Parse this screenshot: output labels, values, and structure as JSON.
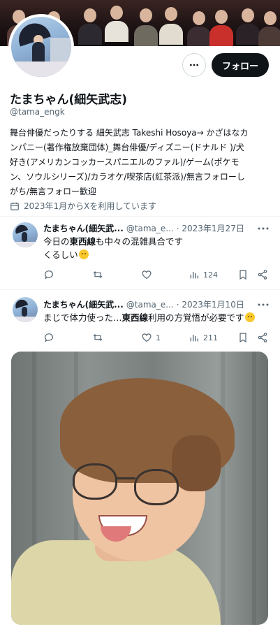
{
  "profile": {
    "display_name": "たまちゃん(細矢武志)",
    "handle": "@tama_engk",
    "bio": "舞台俳優だったりする 細矢武志 Takeshi Hosoya→ かざはなカ\nンパニー(著作権放棄団体)_舞台俳優/ディズニー(ドナルド )/犬\n好き(アメリカンコッカースパニエルのファル)/ゲーム(ポケモ\nン、ソウルシリーズ)/カラオケ/喫茶店(紅茶派)/無言フォローし\nがち/無言フォロー歓迎",
    "joined": "2023年1月からXを利用しています",
    "follow_label": "フォロー"
  },
  "tweets": [
    {
      "name": "たまちゃん(細矢武...",
      "handle": "@tama_e...",
      "date": "· 2023年1月27日",
      "line1_pre": "今日の",
      "line1_bold": "東西線",
      "line1_post": "も中々の混雑具合です",
      "line2": "くるしい",
      "reply": "",
      "retweet": "",
      "like": "",
      "views": "124"
    },
    {
      "name": "たまちゃん(細矢武...",
      "handle": "@tama_e...",
      "date": "· 2023年1月10日",
      "line1_pre": "まじで体力使った…",
      "line1_bold": "東西線",
      "line1_post": "利用の方覚悟が必要です",
      "reply": "",
      "retweet": "",
      "like": "1",
      "views": "211"
    }
  ],
  "icons": {
    "more": "more-horizontal-icon",
    "calendar": "calendar-icon",
    "reply": "reply-icon",
    "retweet": "retweet-icon",
    "like": "heart-icon",
    "views": "views-icon",
    "bookmark": "bookmark-icon",
    "share": "share-icon"
  },
  "colors": {
    "text": "#0f1419",
    "secondary": "#536471",
    "follow_bg": "#0f1419",
    "divider": "#eff3f4"
  }
}
